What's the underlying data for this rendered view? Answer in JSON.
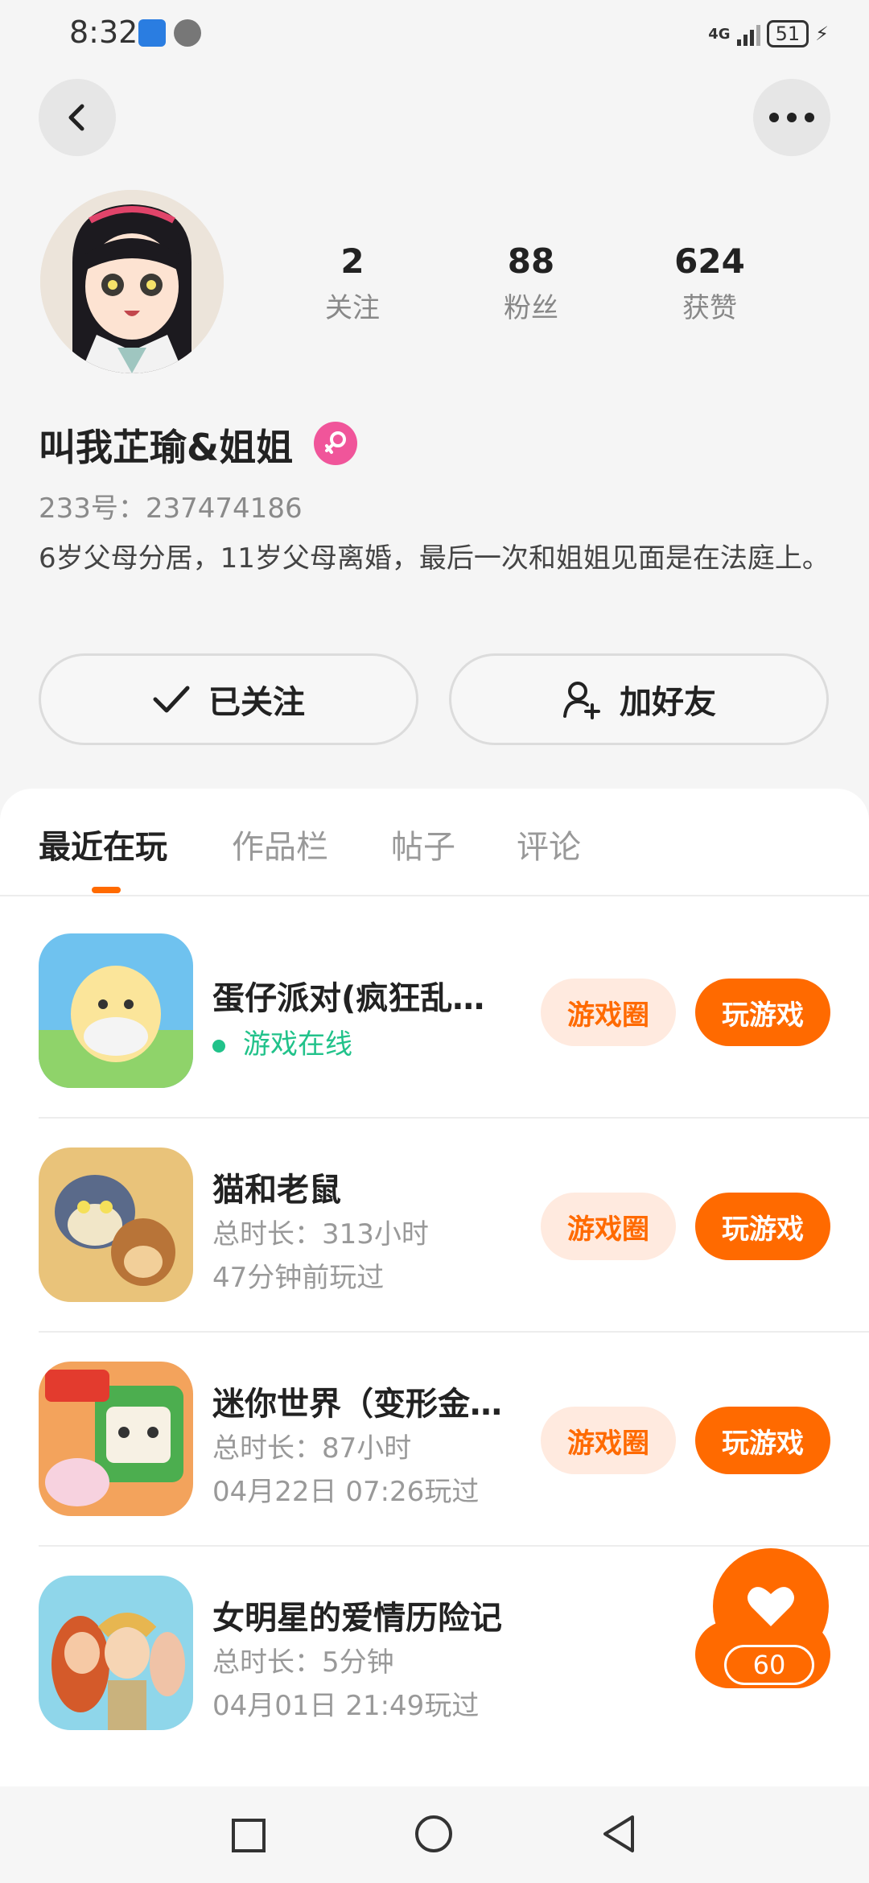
{
  "status_bar": {
    "time": "8:32",
    "network": "4G",
    "battery": "51"
  },
  "profile": {
    "stats": [
      {
        "value": "2",
        "label": "关注"
      },
      {
        "value": "88",
        "label": "粉丝"
      },
      {
        "value": "624",
        "label": "获赞"
      }
    ],
    "username": "叫我芷瑜&姐姐",
    "uid": "233号：237474186",
    "bio": "6岁父母分居，11岁父母离婚，最后一次和姐姐见面是在法庭上。",
    "follow_label": "已关注",
    "add_friend_label": "加好友"
  },
  "tabs": [
    {
      "label": "最近在玩"
    },
    {
      "label": "作品栏"
    },
    {
      "label": "帖子"
    },
    {
      "label": "评论"
    }
  ],
  "games": [
    {
      "title": "蛋仔派对(疯狂乱…",
      "line1": "游戏在线",
      "line2": "",
      "circle_label": "游戏圈",
      "play_label": "玩游戏"
    },
    {
      "title": "猫和老鼠",
      "line1": "总时长：313小时",
      "line2": "47分钟前玩过",
      "circle_label": "游戏圈",
      "play_label": "玩游戏"
    },
    {
      "title": "迷你世界（变形金…",
      "line1": "总时长：87小时",
      "line2": "04月22日 07:26玩过",
      "circle_label": "游戏圈",
      "play_label": "玩游戏"
    },
    {
      "title": "女明星的爱情历险记",
      "line1": "总时长：5分钟",
      "line2": "04月01日 21:49玩过"
    }
  ],
  "like_button": {
    "count": "60"
  },
  "colors": {
    "accent": "#ff6a00",
    "online": "#21c28a",
    "gender_badge": "#f0559a"
  }
}
